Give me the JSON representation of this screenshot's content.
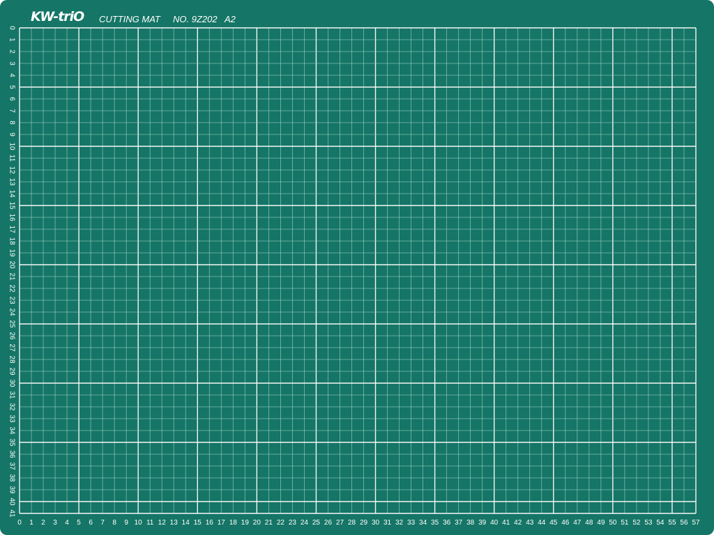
{
  "mat": {
    "brand": "KW-triO",
    "product": "CUTTING MAT",
    "model": "NO. 9Z202   A2",
    "colors": {
      "background": "#157566",
      "minor_line": "#9fd6c6",
      "major_line": "#ffffff",
      "text": "#ffffff"
    }
  },
  "ruler": {
    "x_labels": [
      "0",
      "1",
      "2",
      "3",
      "4",
      "5",
      "6",
      "7",
      "8",
      "9",
      "10",
      "11",
      "12",
      "13",
      "14",
      "15",
      "16",
      "17",
      "18",
      "19",
      "20",
      "21",
      "22",
      "23",
      "24",
      "25",
      "26",
      "27",
      "28",
      "29",
      "30",
      "31",
      "32",
      "33",
      "34",
      "35",
      "36",
      "37",
      "38",
      "39",
      "40",
      "41",
      "42",
      "43",
      "44",
      "45",
      "46",
      "47",
      "48",
      "49",
      "50",
      "51",
      "52",
      "53",
      "54",
      "55",
      "56",
      "57"
    ],
    "y_labels": [
      "0",
      "1",
      "2",
      "3",
      "4",
      "5",
      "6",
      "7",
      "8",
      "9",
      "10",
      "11",
      "12",
      "13",
      "14",
      "15",
      "16",
      "17",
      "18",
      "19",
      "20",
      "21",
      "22",
      "23",
      "24",
      "25",
      "26",
      "27",
      "28",
      "29",
      "30",
      "31",
      "32",
      "33",
      "34",
      "35",
      "36",
      "37",
      "38",
      "39",
      "40",
      "41"
    ],
    "major_every": 5,
    "units": "cm"
  }
}
